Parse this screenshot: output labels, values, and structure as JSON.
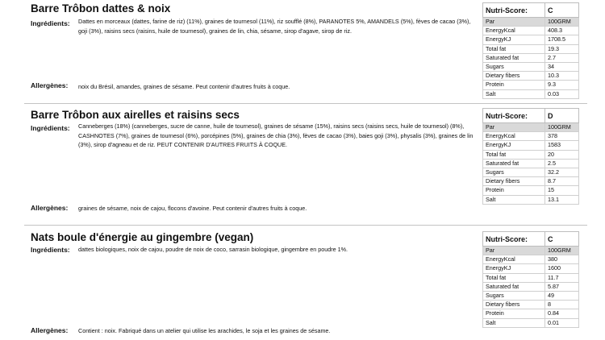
{
  "labels": {
    "ingredients": "Ingrédients:",
    "allergens": "Allergènes:"
  },
  "products": [
    {
      "title": "Barre Trôbon dattes & noix",
      "ingredients": "Dattes en morceaux (dattes, farine de riz) (11%), graines de tournesol (11%), riz soufflé (8%), PARANOTES 5%, AMANDELS (5%), fèves de cacao (3%), goji (3%), raisins secs (raisins, huile de tournesol), graines de lin, chia, sésame, sirop d'agave, sirop de riz.",
      "allergens": "noix du Brésil, amandes, graines de sésame. Peut contenir d'autres fruits à coque.",
      "nutri": {
        "score_label": "Nutri-Score:",
        "score": "C",
        "rows": [
          {
            "key": "Par",
            "value": "100GRM"
          },
          {
            "key": "EnergyKcal",
            "value": "408.3"
          },
          {
            "key": "EnergyKJ",
            "value": "1708.5"
          },
          {
            "key": "Total fat",
            "value": "19.3"
          },
          {
            "key": "Saturated fat",
            "value": "2.7"
          },
          {
            "key": "Sugars",
            "value": "34"
          },
          {
            "key": "Dietary fibers",
            "value": "10.3"
          },
          {
            "key": "Protein",
            "value": "9.3"
          },
          {
            "key": "Salt",
            "value": "0.03"
          }
        ]
      }
    },
    {
      "title": "Barre Trôbon aux airelles et raisins secs",
      "ingredients": "Canneberges (18%) (canneberges, sucre de canne, huile de tournesol), graines de sésame (15%), raisins secs (raisins secs, huile de tournesol) (8%), CASHNOTES (7%), graines de tournesol (6%), porcépines (5%), graines de chia (3%), fèves de cacao (3%), baies goji (3%), physalis (3%), graines de lin (3%), sirop d'agneau et de riz. PEUT CONTENIR D'AUTRES FRUITS À COQUE.",
      "allergens": "graines de sésame, noix de cajou, flocons d'avoine. Peut contenir d'autres fruits à coque.",
      "nutri": {
        "score_label": "Nutri-Score:",
        "score": "D",
        "rows": [
          {
            "key": "Par",
            "value": "100GRM"
          },
          {
            "key": "EnergyKcal",
            "value": "378"
          },
          {
            "key": "EnergyKJ",
            "value": "1583"
          },
          {
            "key": "Total fat",
            "value": "20"
          },
          {
            "key": "Saturated fat",
            "value": "2.5"
          },
          {
            "key": "Sugars",
            "value": "32.2"
          },
          {
            "key": "Dietary fibers",
            "value": "8.7"
          },
          {
            "key": "Protein",
            "value": "15"
          },
          {
            "key": "Salt",
            "value": "13.1"
          }
        ]
      }
    },
    {
      "title": "Nats boule d'énergie au gingembre (vegan)",
      "ingredients": "dattes biologiques, noix de cajou, poudre de noix de coco, sarrasin biologique, gingembre en poudre 1%.",
      "allergens": "Contient : noix. Fabriqué dans un atelier qui utilise les arachides, le soja et les graines de sésame.",
      "nutri": {
        "score_label": "Nutri-Score:",
        "score": "C",
        "rows": [
          {
            "key": "Par",
            "value": "100GRM"
          },
          {
            "key": "EnergyKcal",
            "value": "380"
          },
          {
            "key": "EnergyKJ",
            "value": "1600"
          },
          {
            "key": "Total fat",
            "value": "11.7"
          },
          {
            "key": "Saturated fat",
            "value": "5.87"
          },
          {
            "key": "Sugars",
            "value": "49"
          },
          {
            "key": "Dietary fibers",
            "value": "8"
          },
          {
            "key": "Protein",
            "value": "0.84"
          },
          {
            "key": "Salt",
            "value": "0.01"
          }
        ]
      }
    }
  ]
}
